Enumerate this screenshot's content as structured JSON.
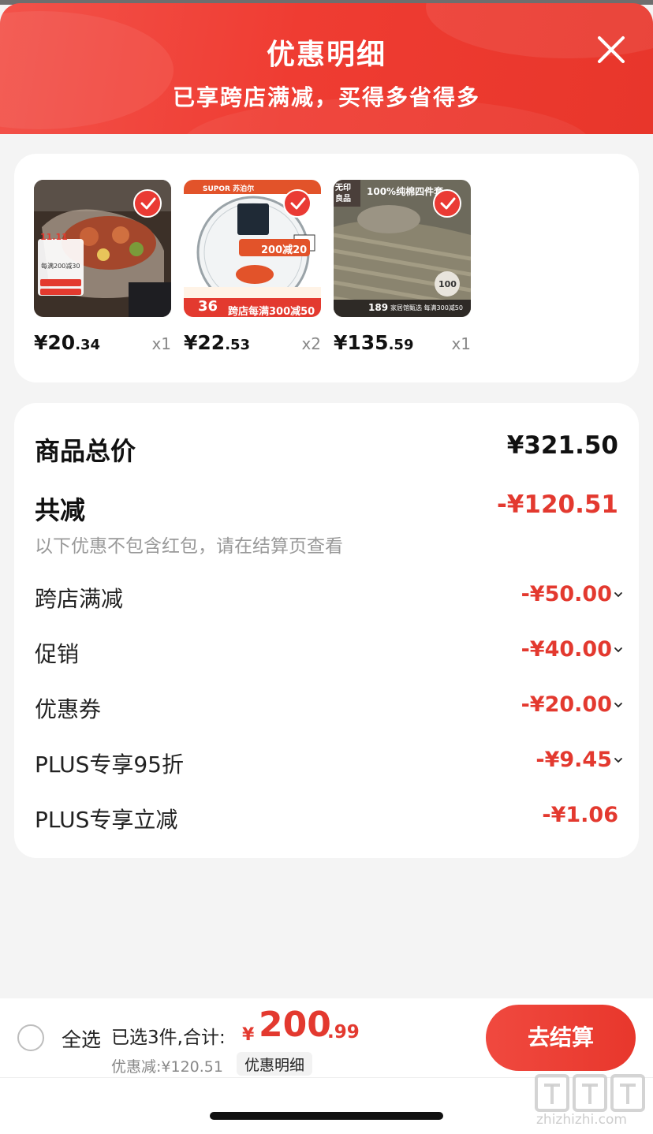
{
  "header": {
    "title": "优惠明细",
    "subtitle": "已享跨店满减，买得多省得多"
  },
  "products": [
    {
      "price_int": "¥20",
      "price_dec": ".34",
      "qty": "x1",
      "image": "roasted-food-dish-photo",
      "checked": true
    },
    {
      "price_int": "¥22",
      "price_dec": ".53",
      "qty": "x2",
      "image": "supor-glass-pot-lid-photo",
      "checked": true
    },
    {
      "price_int": "¥135",
      "price_dec": ".59",
      "qty": "x1",
      "image": "striped-bedding-set-photo",
      "checked": true
    }
  ],
  "product_badges": {
    "p1_event": "11.11",
    "p1_promo": "每满200减30",
    "p2_brand": "SUPOR 苏泊尔",
    "p2_promo": "200减20",
    "p2_price": "36",
    "p2_banner": "跨店每满300减50",
    "p3_brand": "无印 良品",
    "p3_title": "100%纯棉四件套",
    "p3_price": "189",
    "p3_banner": "家居馆甄选 每满300减50",
    "p3_badge": "100"
  },
  "summary": {
    "total_label": "商品总价",
    "total_value": "¥321.50",
    "reduce_label": "共减",
    "reduce_value": "-¥120.51",
    "note": "以下优惠不包含红包，请在结算页查看",
    "items": [
      {
        "label": "跨店满减",
        "value": "-¥50.00",
        "expandable": true
      },
      {
        "label": "促销",
        "value": "-¥40.00",
        "expandable": true
      },
      {
        "label": "优惠券",
        "value": "-¥20.00",
        "expandable": true
      },
      {
        "label": "PLUS专享95折",
        "value": "-¥9.45",
        "expandable": true
      },
      {
        "label": "PLUS专享立减",
        "value": "-¥1.06",
        "expandable": false
      }
    ]
  },
  "bottom": {
    "select_all": "全选",
    "selected_count": "已选3件,合计:",
    "total_yen": "¥",
    "total_int": "200",
    "total_dec": ".99",
    "discount_text": "优惠减:¥120.51",
    "detail_link": "优惠明细",
    "checkout": "去结算"
  },
  "watermark": "zhizhizhi.com",
  "colors": {
    "accent_red": "#e3392f",
    "header_red": "#ef3c32",
    "background": "#f4f4f4"
  }
}
